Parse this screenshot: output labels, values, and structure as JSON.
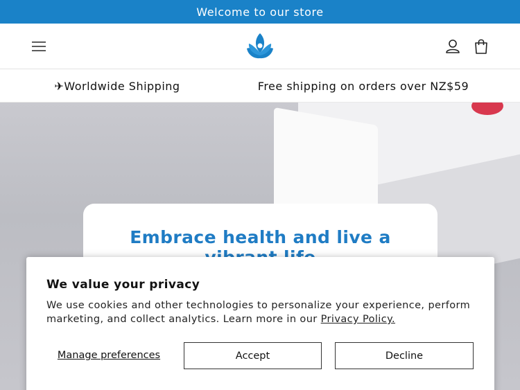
{
  "announcement": {
    "text": "Welcome to our store"
  },
  "header": {
    "menu_icon": "hamburger-menu-icon",
    "logo_icon": "lotus-logo-icon",
    "account_icon": "user-account-icon",
    "cart_icon": "shopping-bag-icon",
    "brand_color": "#1a82c8"
  },
  "shipping_bar": {
    "left_text": "✈Worldwide Shipping",
    "right_text": "Free shipping on orders over NZ$59"
  },
  "hero": {
    "heading": "Embrace health and live a vibrant life"
  },
  "cookie_banner": {
    "title": "We value your privacy",
    "body": "We use cookies and other technologies to personalize your experience, perform marketing, and collect analytics. Learn more in our ",
    "link_text": "Privacy Policy.",
    "manage_label": "Manage preferences",
    "accept_label": "Accept",
    "decline_label": "Decline"
  }
}
